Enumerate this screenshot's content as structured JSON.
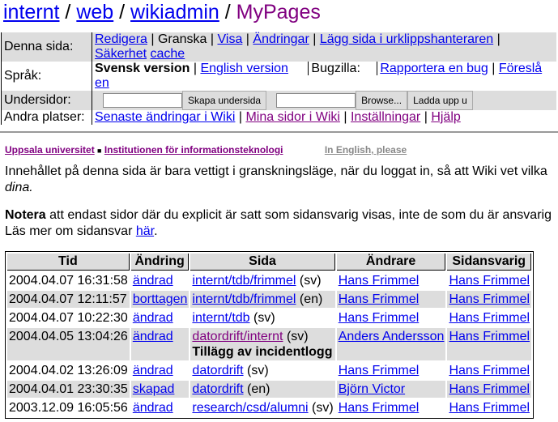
{
  "breadcrumb": [
    "internt",
    "web",
    "wikiadmin",
    "MyPages"
  ],
  "nav": {
    "denna_sida": {
      "label": "Denna sida:",
      "items": [
        "Redigera",
        "Granska",
        "Visa",
        "Ändringar",
        "Lägg sida i urklippshanteraren",
        "Säkerhet",
        "cache"
      ]
    },
    "sprak": {
      "label": "Språk:",
      "current": "Svensk version",
      "english": "English version",
      "bugzilla_label": "Bugzilla:",
      "report": "Rapportera en bug",
      "suggest": "Föreslå en"
    },
    "undersidor": {
      "label": "Undersidor:",
      "create_button": "Skapa undersida",
      "browse_button": "Browse...",
      "upload_button": "Ladda upp u"
    },
    "andra": {
      "label": "Andra platser:",
      "items": [
        "Senaste ändringar i Wiki",
        "Mina sidor i Wiki",
        "Inställningar",
        "Hjälp"
      ]
    }
  },
  "org": {
    "uu": "Uppsala universitet",
    "dept": "Institutionen för informationsteknologi",
    "english": "In English, please"
  },
  "text": {
    "p1": "Innehållet på denna sida är bara vettigt i granskningsläge, när du loggat in, så att Wiki vet vilka",
    "p1b": "dina.",
    "p2_bold": "Notera",
    "p2": " att endast sidor där du explicit är satt som sidansvarig visas, inte de som du är ansvarig",
    "p3": "Läs mer om sidansvar ",
    "p3_link": "här",
    "p3_end": "."
  },
  "table": {
    "headers": [
      "Tid",
      "Ändring",
      "Sida",
      "Ändrare",
      "Sidansvarig"
    ],
    "rows": [
      {
        "time": "2004.04.07 16:31:58",
        "change": "ändrad",
        "page": "internt/tdb/frimmel",
        "lang": "(sv)",
        "note": "",
        "editor": "Hans Frimmel",
        "owner": "Hans Frimmel"
      },
      {
        "time": "2004.04.07 12:11:57",
        "change": "borttagen",
        "page": "internt/tdb/frimmel",
        "lang": "(en)",
        "note": "",
        "editor": "Hans Frimmel",
        "owner": "Hans Frimmel"
      },
      {
        "time": "2004.04.07 10:22:30",
        "change": "ändrad",
        "page": "internt/tdb",
        "lang": "(sv)",
        "note": "",
        "editor": "Hans Frimmel",
        "owner": "Hans Frimmel"
      },
      {
        "time": "2004.04.05 13:04:26",
        "change": "ändrad",
        "page": "datordrift/internt",
        "lang": "(sv)",
        "note": "Tillägg av incidentlogg",
        "editor": "Anders Andersson",
        "owner": "Hans Frimmel"
      },
      {
        "time": "2004.04.02 13:26:09",
        "change": "ändrad",
        "page": "datordrift",
        "lang": "(sv)",
        "note": "",
        "editor": "Hans Frimmel",
        "owner": "Hans Frimmel"
      },
      {
        "time": "2004.04.01 23:30:35",
        "change": "skapad",
        "page": "datordrift",
        "lang": "(en)",
        "note": "",
        "editor": "Björn Victor",
        "owner": "Hans Frimmel"
      },
      {
        "time": "2003.12.09 16:05:56",
        "change": "ändrad",
        "page": "research/csd/alumni",
        "lang": "(sv)",
        "note": "",
        "editor": "Hans Frimmel",
        "owner": "Hans Frimmel"
      }
    ]
  }
}
